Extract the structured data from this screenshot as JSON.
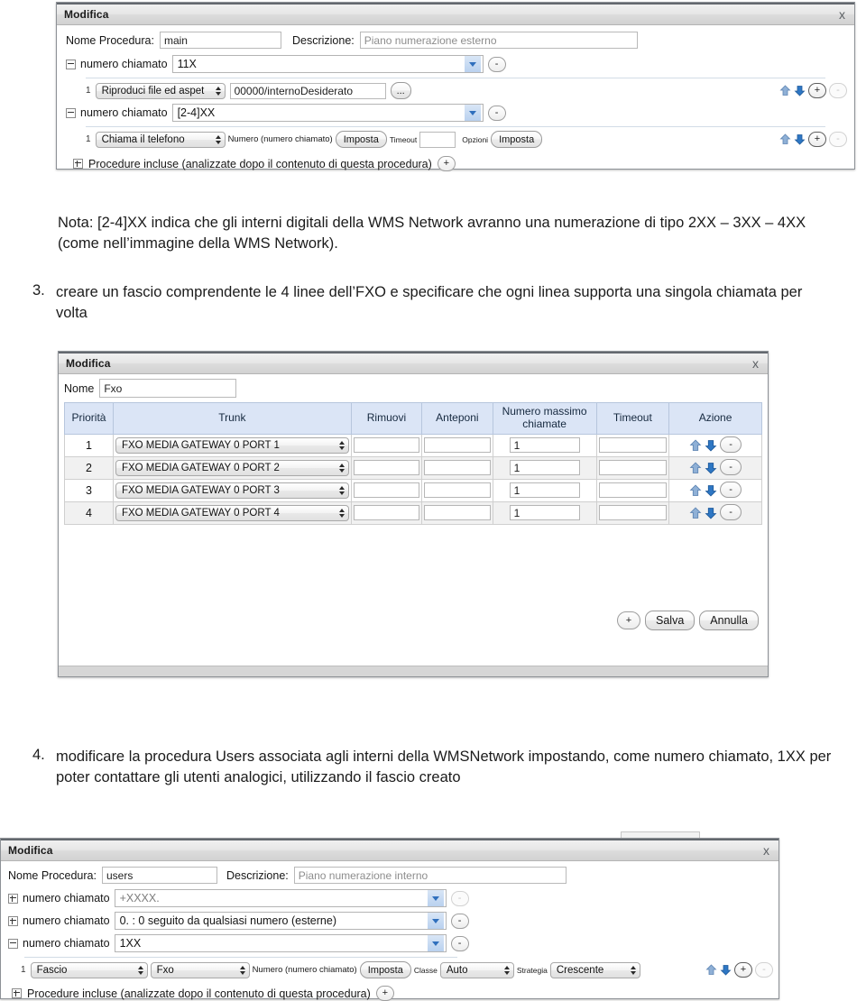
{
  "document": {
    "note_paragraph": "Nota: [2-4]XX indica che gli interni digitali della WMS Network avranno una numerazione di tipo 2XX – 3XX – 4XX (come nell’immagine della WMS Network).",
    "items": [
      {
        "number": "3.",
        "text": "creare un fascio comprendente le 4 linee dell’FXO e specificare che ogni linea supporta una singola chiamata per volta"
      },
      {
        "number": "4.",
        "text": "modificare la procedura Users associata agli interni della WMSNetwork impostando, come numero chiamato, 1XX per poter contattare gli utenti analogici, utilizzando il fascio creato"
      }
    ]
  },
  "dialog_main": {
    "title": "Modifica",
    "close_label": "x",
    "fields": {
      "procedure_name_label": "Nome Procedura:",
      "procedure_name_value": "main",
      "description_label": "Descrizione:",
      "description_value": "Piano numerazione esterno"
    },
    "rules": [
      {
        "tree_state": "minus",
        "label": "numero chiamato",
        "value": "11X",
        "remove_label": "-",
        "action": {
          "index": "1",
          "type": "Riproduci file ed aspet",
          "argument": "00000/internoDesiderato",
          "browse_label": "...",
          "up_label": "up-arrow",
          "down_label": "down-arrow",
          "add_label": "+",
          "remove_label": "-"
        }
      },
      {
        "tree_state": "minus",
        "label": "numero chiamato",
        "value": "[2-4]XX",
        "remove_label": "-",
        "action": {
          "index": "1",
          "type": "Chiama il telefono",
          "numero_label": "Numero (numero chiamato)",
          "numero_button": "Imposta",
          "timeout_label": "Timeout",
          "timeout_value": "",
          "opzioni_label": "Opzioni",
          "opzioni_button": "Imposta",
          "up_label": "up-arrow",
          "down_label": "down-arrow",
          "add_label": "+",
          "remove_label": "-"
        }
      }
    ],
    "included_procedures": {
      "tree_state": "plus",
      "label": "Procedure incluse (analizzate dopo il contenuto di questa procedura)",
      "add_label": "+"
    }
  },
  "dialog_trunk": {
    "title": "Modifica",
    "close_label": "x",
    "name_label": "Nome",
    "name_value": "Fxo",
    "columns": [
      "Priorità",
      "Trunk",
      "Rimuovi",
      "Anteponi",
      "Numero massimo chiamate",
      "Timeout",
      "Azione"
    ],
    "rows": [
      {
        "priorita": "1",
        "trunk": "FXO MEDIA GATEWAY 0 PORT 1",
        "rimuovi": "",
        "anteponi": "",
        "max_chiamate": "1",
        "timeout": "",
        "up": "up-arrow",
        "down": "down-arrow",
        "remove": "-"
      },
      {
        "priorita": "2",
        "trunk": "FXO MEDIA GATEWAY 0 PORT 2",
        "rimuovi": "",
        "anteponi": "",
        "max_chiamate": "1",
        "timeout": "",
        "up": "up-arrow",
        "down": "down-arrow",
        "remove": "-"
      },
      {
        "priorita": "3",
        "trunk": "FXO MEDIA GATEWAY 0 PORT 3",
        "rimuovi": "",
        "anteponi": "",
        "max_chiamate": "1",
        "timeout": "",
        "up": "up-arrow",
        "down": "down-arrow",
        "remove": "-"
      },
      {
        "priorita": "4",
        "trunk": "FXO MEDIA GATEWAY 0 PORT 4",
        "rimuovi": "",
        "anteponi": "",
        "max_chiamate": "1",
        "timeout": "",
        "up": "up-arrow",
        "down": "down-arrow",
        "remove": "-"
      }
    ],
    "footer": {
      "add_label": "+",
      "save_label": "Salva",
      "cancel_label": "Annulla"
    }
  },
  "dialog_users": {
    "title": "Modifica",
    "close_label": "x",
    "fields": {
      "procedure_name_label": "Nome Procedura:",
      "procedure_name_value": "users",
      "description_label": "Descrizione:",
      "description_value": "Piano numerazione interno"
    },
    "rules": [
      {
        "tree_state": "plus",
        "label": "numero chiamato",
        "value": "+XXXX.",
        "remove_label": "-",
        "remove_dim": true
      },
      {
        "tree_state": "plus",
        "label": "numero chiamato",
        "value": "0. : 0 seguito da qualsiasi numero (esterne)",
        "remove_label": "-",
        "remove_dim": false
      },
      {
        "tree_state": "minus",
        "label": "numero chiamato",
        "value": "1XX",
        "remove_label": "-",
        "remove_dim": false
      }
    ],
    "action_row": {
      "index": "1",
      "type": "Fascio",
      "trunk": "Fxo",
      "numero_label": "Numero (numero chiamato)",
      "numero_button": "Imposta",
      "classe_label": "Classe",
      "classe_value": "Auto",
      "strategia_label": "Strategia",
      "strategia_value": "Crescente",
      "up_label": "up-arrow",
      "down_label": "down-arrow",
      "add_label": "+",
      "remove_label": "-"
    },
    "included_procedures": {
      "tree_state": "plus",
      "label": "Procedure incluse (analizzate dopo il contenuto di questa procedura)",
      "add_label": "+"
    }
  },
  "colors": {
    "header_blue": "#dbe5f6",
    "arrow_up": "#89a9d0",
    "arrow_down": "#2e77c4",
    "combo_caret": "#2f6fbd",
    "dialog_border": "#8d9196"
  }
}
